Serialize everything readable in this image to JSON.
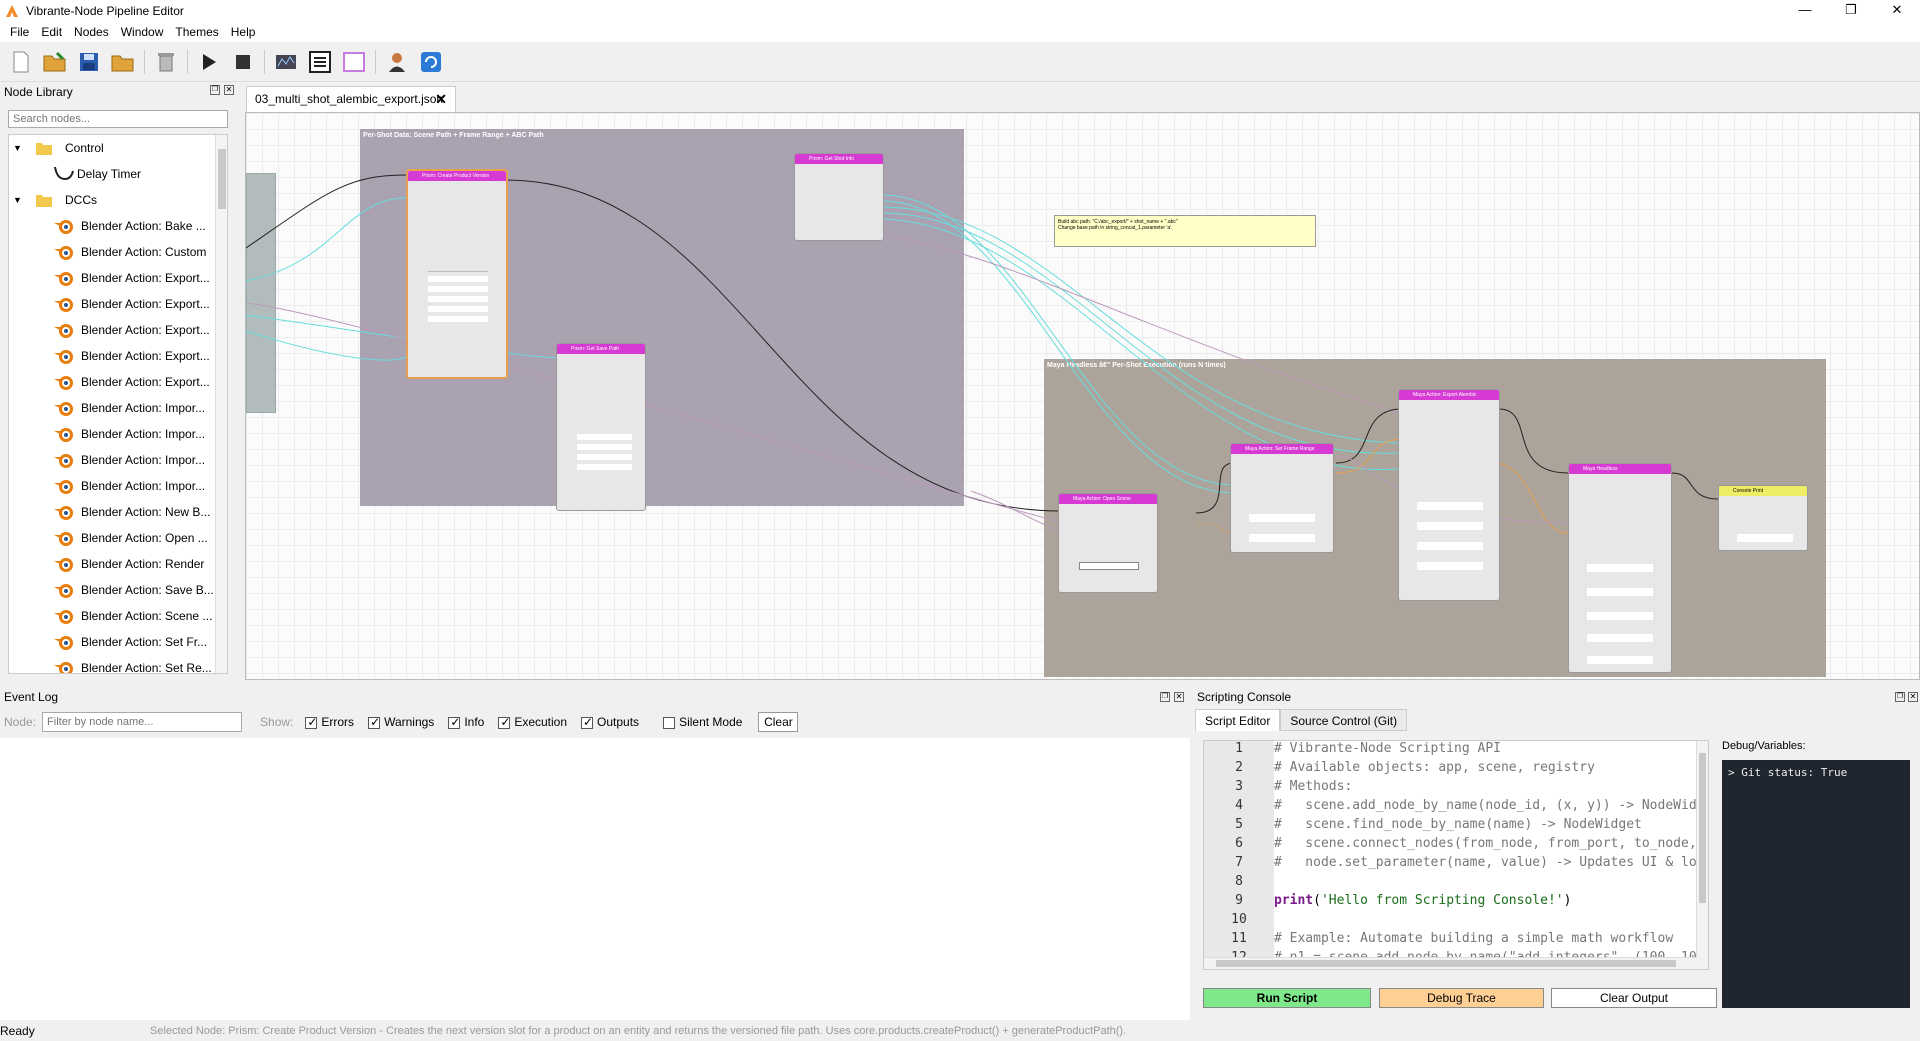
{
  "window": {
    "title": "Vibrante-Node Pipeline Editor",
    "min": "—",
    "max": "❐",
    "close": "✕"
  },
  "menu": [
    "File",
    "Edit",
    "Nodes",
    "Window",
    "Themes",
    "Help"
  ],
  "library": {
    "title": "Node Library",
    "search_placeholder": "Search nodes...",
    "items": [
      {
        "type": "folder",
        "label": "Control",
        "expanded": true
      },
      {
        "type": "leaf",
        "label": "Delay Timer",
        "icon": "timer-icon"
      },
      {
        "type": "folder",
        "label": "DCCs",
        "expanded": true
      },
      {
        "type": "blender",
        "label": "Blender Action: Bake ..."
      },
      {
        "type": "blender",
        "label": "Blender Action: Custom"
      },
      {
        "type": "blender",
        "label": "Blender Action: Export..."
      },
      {
        "type": "blender",
        "label": "Blender Action: Export..."
      },
      {
        "type": "blender",
        "label": "Blender Action: Export..."
      },
      {
        "type": "blender",
        "label": "Blender Action: Export..."
      },
      {
        "type": "blender",
        "label": "Blender Action: Export..."
      },
      {
        "type": "blender",
        "label": "Blender Action: Impor..."
      },
      {
        "type": "blender",
        "label": "Blender Action: Impor..."
      },
      {
        "type": "blender",
        "label": "Blender Action: Impor..."
      },
      {
        "type": "blender",
        "label": "Blender Action: Impor..."
      },
      {
        "type": "blender",
        "label": "Blender Action: New B..."
      },
      {
        "type": "blender",
        "label": "Blender Action: Open ..."
      },
      {
        "type": "blender",
        "label": "Blender Action: Render"
      },
      {
        "type": "blender",
        "label": "Blender Action: Save B..."
      },
      {
        "type": "blender",
        "label": "Blender Action: Scene ..."
      },
      {
        "type": "blender",
        "label": "Blender Action: Set Fr..."
      },
      {
        "type": "blender",
        "label": "Blender Action: Set Re..."
      }
    ]
  },
  "document_tab": {
    "label": "03_multi_shot_alembic_export.json",
    "close": "✕"
  },
  "graph": {
    "group1": "Per-Shot Data: Scene Path + Frame Range + ABC Path",
    "group2": "Maya Headless â€\" Per-Shot Execution (runs N times)",
    "note": "Build abc path: \"C:/abc_export/\" + shot_name + \".abc\"\nChange base path in string_concat_1.parameter 'a'.",
    "nodes": {
      "prism_create": "Prism: Create Product Version",
      "prism_shot_info": "Prism: Get Shot Info",
      "prism_save_path": "Prism: Get Save Path",
      "maya_open": "Maya Action: Open Scene",
      "maya_frame_range": "Maya Action: Set Frame Range",
      "maya_export_alembic": "Maya Action: Export Alembic",
      "maya_headless": "Maya Headless",
      "console_print": "Console Print"
    }
  },
  "event_log": {
    "title": "Event Log",
    "node_label": "Node:",
    "filter_placeholder": "Filter by node name...",
    "show_label": "Show:",
    "filters": [
      {
        "label": "Errors",
        "checked": true
      },
      {
        "label": "Warnings",
        "checked": true
      },
      {
        "label": "Info",
        "checked": true
      },
      {
        "label": "Execution",
        "checked": true
      },
      {
        "label": "Outputs",
        "checked": true
      },
      {
        "label": "Silent Mode",
        "checked": false
      }
    ],
    "clear": "Clear"
  },
  "console": {
    "title": "Scripting Console",
    "tabs": [
      "Script Editor",
      "Source Control (Git)"
    ],
    "lines": [
      "# Vibrante-Node Scripting API",
      "# Available objects: app, scene, registry",
      "# Methods:",
      "#   scene.add_node_by_name(node_id, (x, y)) -> NodeWid",
      "#   scene.find_node_by_name(name) -> NodeWidget",
      "#   scene.connect_nodes(from_node, from_port, to_node,",
      "#   node.set_parameter(name, value) -> Updates UI & lo",
      "",
      "print('Hello from Scripting Console!')",
      "",
      "# Example: Automate building a simple math workflow",
      "# n1 = scene.add_node_by_name(\"add_integers\", (100, 10"
    ],
    "print_fn": "print",
    "print_arg": "'Hello from Scripting Console!'",
    "debug_label": "Debug/Variables:",
    "debug_text": "> Git status: True",
    "run": "Run Script",
    "trace": "Debug Trace",
    "clear_output": "Clear Output"
  },
  "status": {
    "ready": "Ready",
    "message": "Selected Node: Prism: Create Product Version - Creates the next version slot for a product on an entity and returns the versioned file path. Uses core.products.createProduct() + generateProductPath()."
  }
}
